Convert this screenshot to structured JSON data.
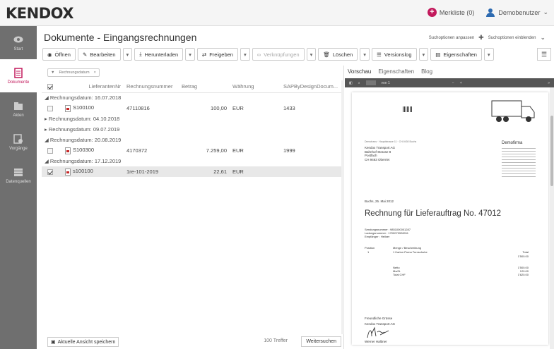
{
  "app": {
    "logo": "KENDOX",
    "merkliste": "Merkliste (0)",
    "user": "Demobenutzer"
  },
  "sidebar": {
    "items": [
      {
        "label": "Start"
      },
      {
        "label": "Dokumente"
      },
      {
        "label": "Akten"
      },
      {
        "label": "Vorgänge"
      },
      {
        "label": "Datenquellen"
      }
    ]
  },
  "page": {
    "title": "Dokumente - Eingangsrechnungen",
    "search_adjust": "Suchoptionen anpassen",
    "search_show": "Suchoptionen einblenden"
  },
  "toolbar": {
    "open": "Öffnen",
    "edit": "Bearbeiten",
    "download": "Herunterladen",
    "share": "Freigeben",
    "links": "Verknüpfungen",
    "delete": "Löschen",
    "versions": "Versionslog",
    "properties": "Eigenschaften"
  },
  "filter": {
    "label": "Rechnungsdatum"
  },
  "table": {
    "headers": [
      "LieferantenNr",
      "Rechnungsnummer",
      "Betrag",
      "Währung",
      "SAPByDesignDocum..."
    ],
    "rows": [
      {
        "type": "group",
        "label": "Rechnungsdatum: 16.07.2018"
      },
      {
        "type": "row",
        "lieferant": "S100100",
        "rechnung": "47110816",
        "betrag": "100,00",
        "waehrung": "EUR",
        "sap": "1433"
      },
      {
        "type": "group",
        "label": "Rechnungsdatum: 04.10.2018"
      },
      {
        "type": "group",
        "label": "Rechnungsdatum: 09.07.2019"
      },
      {
        "type": "group",
        "label": "Rechnungsdatum: 20.08.2019"
      },
      {
        "type": "row",
        "lieferant": "S100300",
        "rechnung": "4170372",
        "betrag": "7.259,00",
        "waehrung": "EUR",
        "sap": "1999"
      },
      {
        "type": "group",
        "label": "Rechnungsdatum: 17.12.2019"
      },
      {
        "type": "row",
        "lieferant": "s100100",
        "rechnung": "1re-101-2019",
        "betrag": "22,61",
        "waehrung": "EUR",
        "sap": "",
        "selected": true
      }
    ]
  },
  "bottom": {
    "save": "Aktuelle Ansicht speichern",
    "hits": "100 Treffer",
    "continue": "Weitersuchen"
  },
  "preview": {
    "tabs": [
      "Vorschau",
      "Eigenschaften",
      "Blog"
    ],
    "page": "von 1",
    "doc": {
      "sender_line": "Demotrans · Hauptstrasse 11 · CH-9430 Buchs",
      "recipient": [
        "Kendox Transport AG",
        "Bahnhof-Strasse 8",
        "Postfach",
        "CH 9463 Oberriet"
      ],
      "company": "Demofirma",
      "date": "Buchs, 25. Mai 2012",
      "heading": "Rechnung für Lieferauftrag No. 47012",
      "meta": [
        "Sendungsnummer : 9851000001287",
        "Ladungsnummer : 1700070928011",
        "Empfänger : Heilser"
      ],
      "pos_header": [
        "Position",
        "Menge / Beschreibung",
        "Total"
      ],
      "pos_line": [
        "1",
        "1 Karton Puma Turnschuhe",
        "1'500.00"
      ],
      "totals": [
        [
          "Netto",
          "1'500.00"
        ],
        [
          "MwSt.",
          "120.00"
        ],
        [
          "Total CHF",
          "1'620.00"
        ]
      ],
      "greeting": "Freundliche Grüsse",
      "greeting_company": "Kendox Transport AG",
      "signer": "Werner Halbner"
    }
  }
}
